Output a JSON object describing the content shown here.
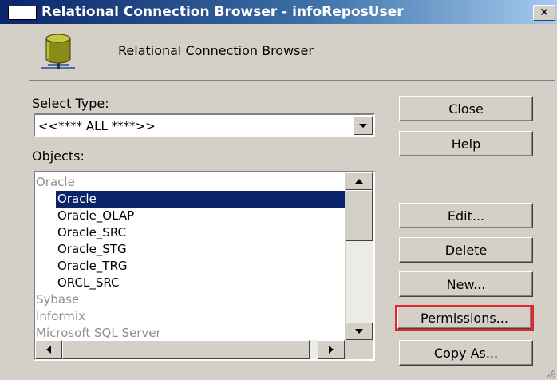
{
  "window": {
    "title": "Relational Connection Browser - infoReposUser",
    "close_glyph": "✕"
  },
  "header": {
    "icon": "database-cylinder-icon",
    "label": "Relational Connection Browser"
  },
  "select_type": {
    "label": "Select Type:",
    "value": "<<**** ALL ****>>"
  },
  "objects": {
    "label": "Objects:",
    "rows": [
      {
        "text": "Oracle",
        "kind": "group"
      },
      {
        "text": "Oracle",
        "kind": "selected"
      },
      {
        "text": "Oracle_OLAP",
        "kind": "item"
      },
      {
        "text": "Oracle_SRC",
        "kind": "item"
      },
      {
        "text": "Oracle_STG",
        "kind": "item"
      },
      {
        "text": "Oracle_TRG",
        "kind": "item"
      },
      {
        "text": "ORCL_SRC",
        "kind": "item"
      },
      {
        "text": "Sybase",
        "kind": "group"
      },
      {
        "text": "Informix",
        "kind": "group"
      },
      {
        "text": "Microsoft SQL Server",
        "kind": "group"
      }
    ]
  },
  "buttons": {
    "close": "Close",
    "help": "Help",
    "edit": "Edit...",
    "delete": "Delete",
    "new": "New...",
    "permissions": "Permissions...",
    "copy_as": "Copy As..."
  },
  "colors": {
    "selection": "#0a246a",
    "highlight_frame": "#e4252b",
    "group_text": "#8f8f8f"
  }
}
